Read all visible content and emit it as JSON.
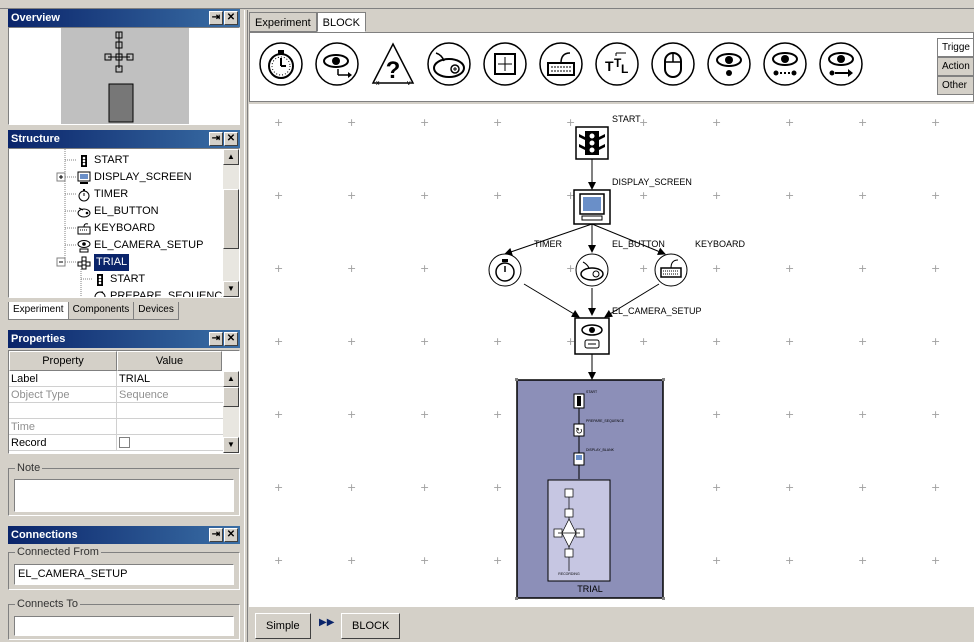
{
  "overview": {
    "title": "Overview"
  },
  "structure": {
    "title": "Structure",
    "items": [
      {
        "label": "START",
        "icon": "traffic-light-icon"
      },
      {
        "label": "DISPLAY_SCREEN",
        "icon": "monitor-icon"
      },
      {
        "label": "TIMER",
        "icon": "stopwatch-icon"
      },
      {
        "label": "EL_BUTTON",
        "icon": "gamepad-icon"
      },
      {
        "label": "KEYBOARD",
        "icon": "keyboard-icon"
      },
      {
        "label": "EL_CAMERA_SETUP",
        "icon": "eye-camera-icon"
      },
      {
        "label": "TRIAL",
        "icon": "sequence-icon"
      },
      {
        "label": "START",
        "icon": "traffic-light-icon"
      },
      {
        "label": "PREPARE_SEQUENCE",
        "icon": "prepare-icon"
      }
    ],
    "tabs": [
      "Experiment",
      "Components",
      "Devices"
    ]
  },
  "properties": {
    "title": "Properties",
    "col_property": "Property",
    "col_value": "Value",
    "rows": [
      {
        "property": "Label",
        "value": "TRIAL"
      },
      {
        "property": "Object Type",
        "value": "Sequence"
      },
      {
        "property": "",
        "value": ""
      },
      {
        "property": "Time",
        "value": ""
      },
      {
        "property": "Record",
        "value": ""
      }
    ]
  },
  "note": {
    "label": "Note",
    "value": ""
  },
  "connections": {
    "title": "Connections",
    "from_label": "Connected From",
    "from_value": "EL_CAMERA_SETUP",
    "to_label": "Connects To",
    "to_value": ""
  },
  "editor_tabs": [
    "Experiment",
    "BLOCK"
  ],
  "toolbar_side_tabs": [
    "Trigge",
    "Action",
    "Other"
  ],
  "toolbar_icons": [
    "stopwatch-icon",
    "eye-arrow-icon",
    "question-triangle-icon",
    "gamepad-icon",
    "grid-box-icon",
    "keyboard-icon",
    "ttl-icon",
    "mouse-icon",
    "eye-dot-icon",
    "eye-dotted-icon",
    "eye-arrow-right-icon"
  ],
  "canvas": {
    "nodes": {
      "start": "START",
      "display": "DISPLAY_SCREEN",
      "timer": "TIMER",
      "button": "EL_BUTTON",
      "keyboard": "KEYBOARD",
      "camera": "EL_CAMERA_SETUP",
      "trial": "TRIAL"
    }
  },
  "bottom": {
    "simple": "Simple",
    "block": "BLOCK"
  }
}
